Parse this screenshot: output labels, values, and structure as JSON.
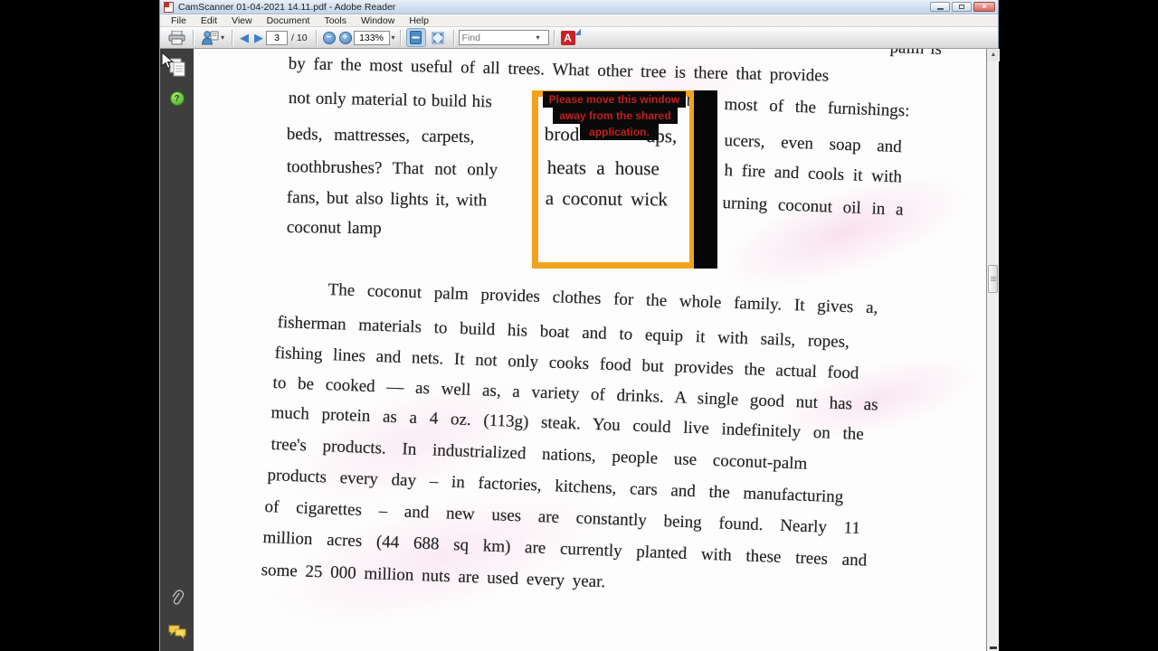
{
  "window": {
    "title": "CamScanner 01-04-2021 14.11.pdf - Adobe Reader"
  },
  "menu": {
    "items": [
      "File",
      "Edit",
      "View",
      "Document",
      "Tools",
      "Window",
      "Help"
    ]
  },
  "toolbar": {
    "page_current": "3",
    "page_total_label": "/ 10",
    "zoom_level": "133%",
    "find_placeholder": "Find",
    "adobe_letter": "A"
  },
  "icons": {
    "back_arrow": "◀",
    "forward_arrow": "▶",
    "minus": "−",
    "plus": "+",
    "caret_down": "▾",
    "close_x": "×",
    "scroll_up_arrow": "▲",
    "help_question": "?"
  },
  "share_overlay": {
    "message_line1": "Please move this window",
    "message_line2": "away from the shared",
    "message_line3": "application.",
    "frame_color": "#f2a31e",
    "text_color": "#bf1f1f"
  },
  "document": {
    "fragments": [
      {
        "text": "palm is"
      },
      {
        "text": "by far the most useful of all trees. What other tree is there that provides"
      },
      {
        "text": "not only material to build his"
      },
      {
        "text": "b"
      },
      {
        "text": "most of the furnishings:"
      },
      {
        "text": "beds, mattresses, carpets,"
      },
      {
        "text": "brod"
      },
      {
        "text": "ups,"
      },
      {
        "text": "ucers, even soap and"
      },
      {
        "text": "toothbrushes? That not only"
      },
      {
        "text": "heats a house"
      },
      {
        "text": "h fire and cools it with"
      },
      {
        "text": "fans, but also lights it, with"
      },
      {
        "text": "a coconut wick"
      },
      {
        "text": "urning coconut oil in a"
      },
      {
        "text": "coconut lamp"
      },
      {
        "text": "The coconut palm provides clothes for the whole family. It gives a,"
      },
      {
        "text": "fisherman materials to build his boat and to equip it with sails, ropes,"
      },
      {
        "text": "fishing lines and nets. It not only cooks food but provides the actual food"
      },
      {
        "text": "to be cooked — as well as, a variety of drinks. A single good nut has as"
      },
      {
        "text": "much protein as a 4 oz. (113g) steak. You could live indefinitely on the"
      },
      {
        "text": "tree's products. In industrialized nations, people use coconut-palm"
      },
      {
        "text": "products every day – in factories, kitchens, cars and the manufacturing"
      },
      {
        "text": "of cigarettes – and new uses are constantly being found. Nearly 11"
      },
      {
        "text": "million acres (44 688 sq km) are currently planted with these trees and"
      },
      {
        "text": "some 25 000 million nuts are used every year."
      }
    ]
  }
}
